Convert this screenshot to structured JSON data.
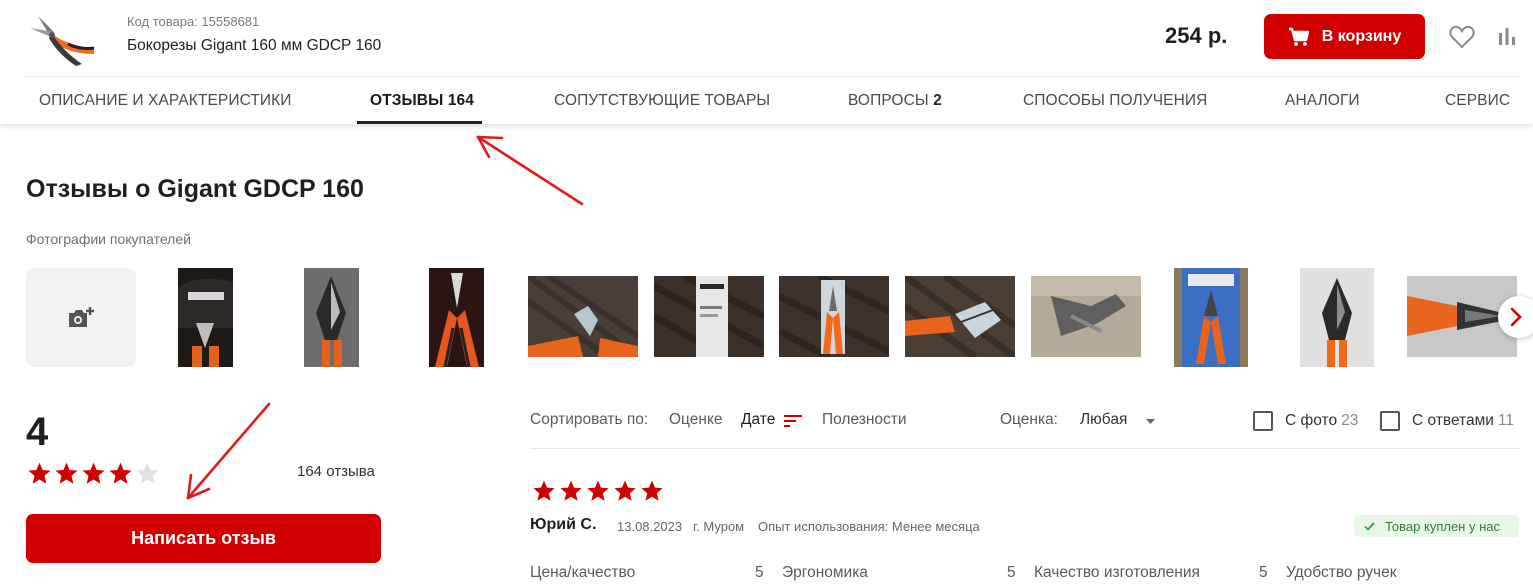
{
  "header": {
    "product_code": "Код товара: 15558681",
    "product_name": "Бокорезы Gigant 160 мм GDCP 160",
    "price": "254 р.",
    "cart_button": "В корзину"
  },
  "tabs": [
    {
      "label": "ОПИСАНИЕ И ХАРАКТЕРИСТИКИ",
      "count": ""
    },
    {
      "label": "ОТЗЫВЫ",
      "count": "164"
    },
    {
      "label": "СОПУТСТВУЮЩИЕ ТОВАРЫ",
      "count": ""
    },
    {
      "label": "ВОПРОСЫ",
      "count": "2"
    },
    {
      "label": "СПОСОБЫ ПОЛУЧЕНИЯ",
      "count": ""
    },
    {
      "label": "АНАЛОГИ",
      "count": ""
    },
    {
      "label": "СЕРВИС",
      "count": ""
    }
  ],
  "reviews": {
    "title": "Отзывы о Gigant GDCP 160",
    "photos_label": "Фотографии покупателей",
    "rating": "4",
    "stars_filled": 4,
    "stars_total": 5,
    "reviews_count": "164 отзыва",
    "write_button": "Написать отзыв"
  },
  "sort": {
    "label": "Сортировать по:",
    "options": [
      "Оценке",
      "Дате",
      "Полезности"
    ],
    "active": "Дате",
    "rating_label": "Оценка:",
    "rating_value": "Любая"
  },
  "filters": {
    "with_photo": {
      "label": "С фото",
      "count": "23"
    },
    "with_answers": {
      "label": "С ответами",
      "count": "11"
    }
  },
  "review": {
    "stars": 5,
    "author": "Юрий С.",
    "date": "13.08.2023",
    "city": "г. Муром",
    "experience": "Опыт использования: Менее месяца",
    "badge": "Товар куплен у нас",
    "criteria": [
      {
        "name": "Цена/качество",
        "value": "5"
      },
      {
        "name": "Эргономика",
        "value": "5"
      },
      {
        "name": "Качество изготовления",
        "value": "5"
      },
      {
        "name": "Удобство ручек",
        "value": ""
      }
    ]
  },
  "colors": {
    "brand_red": "#d10000",
    "star_gray": "#e0e0e0",
    "badge_green_bg": "#e8f7e8",
    "annotation_red": "#e01b1b"
  }
}
